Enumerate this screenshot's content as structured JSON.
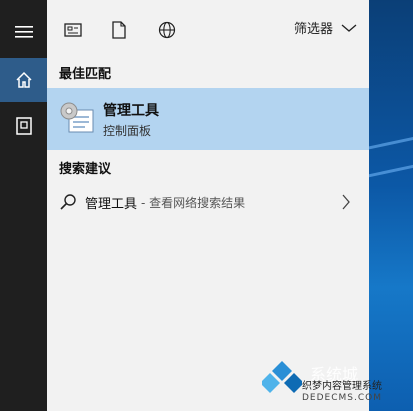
{
  "rail": {
    "items": [
      {
        "icon": "hamburger-menu-icon",
        "active": false
      },
      {
        "icon": "home-icon",
        "active": true
      },
      {
        "icon": "notebook-icon",
        "active": false
      }
    ]
  },
  "toolbar": {
    "icons": [
      "apps-icon",
      "document-icon",
      "web-icon"
    ],
    "filter_label": "筛选器"
  },
  "best_match": {
    "section_title": "最佳匹配",
    "title": "管理工具",
    "subtitle": "控制面板",
    "icon": "admin-tools-icon"
  },
  "suggestions": {
    "section_title": "搜索建议",
    "items": [
      {
        "query": "管理工具",
        "hint": "- 查看网络搜索结果",
        "icon": "search-icon"
      }
    ]
  },
  "watermark": {
    "line1": "系统城",
    "line2": "织梦内容管理系统",
    "line3": "DEDECMS.COM"
  },
  "colors": {
    "rail_bg": "#1f1f1f",
    "rail_active": "#2e5c8a",
    "panel_bg": "#f2f2f2",
    "highlight": "#b3d4f0"
  }
}
